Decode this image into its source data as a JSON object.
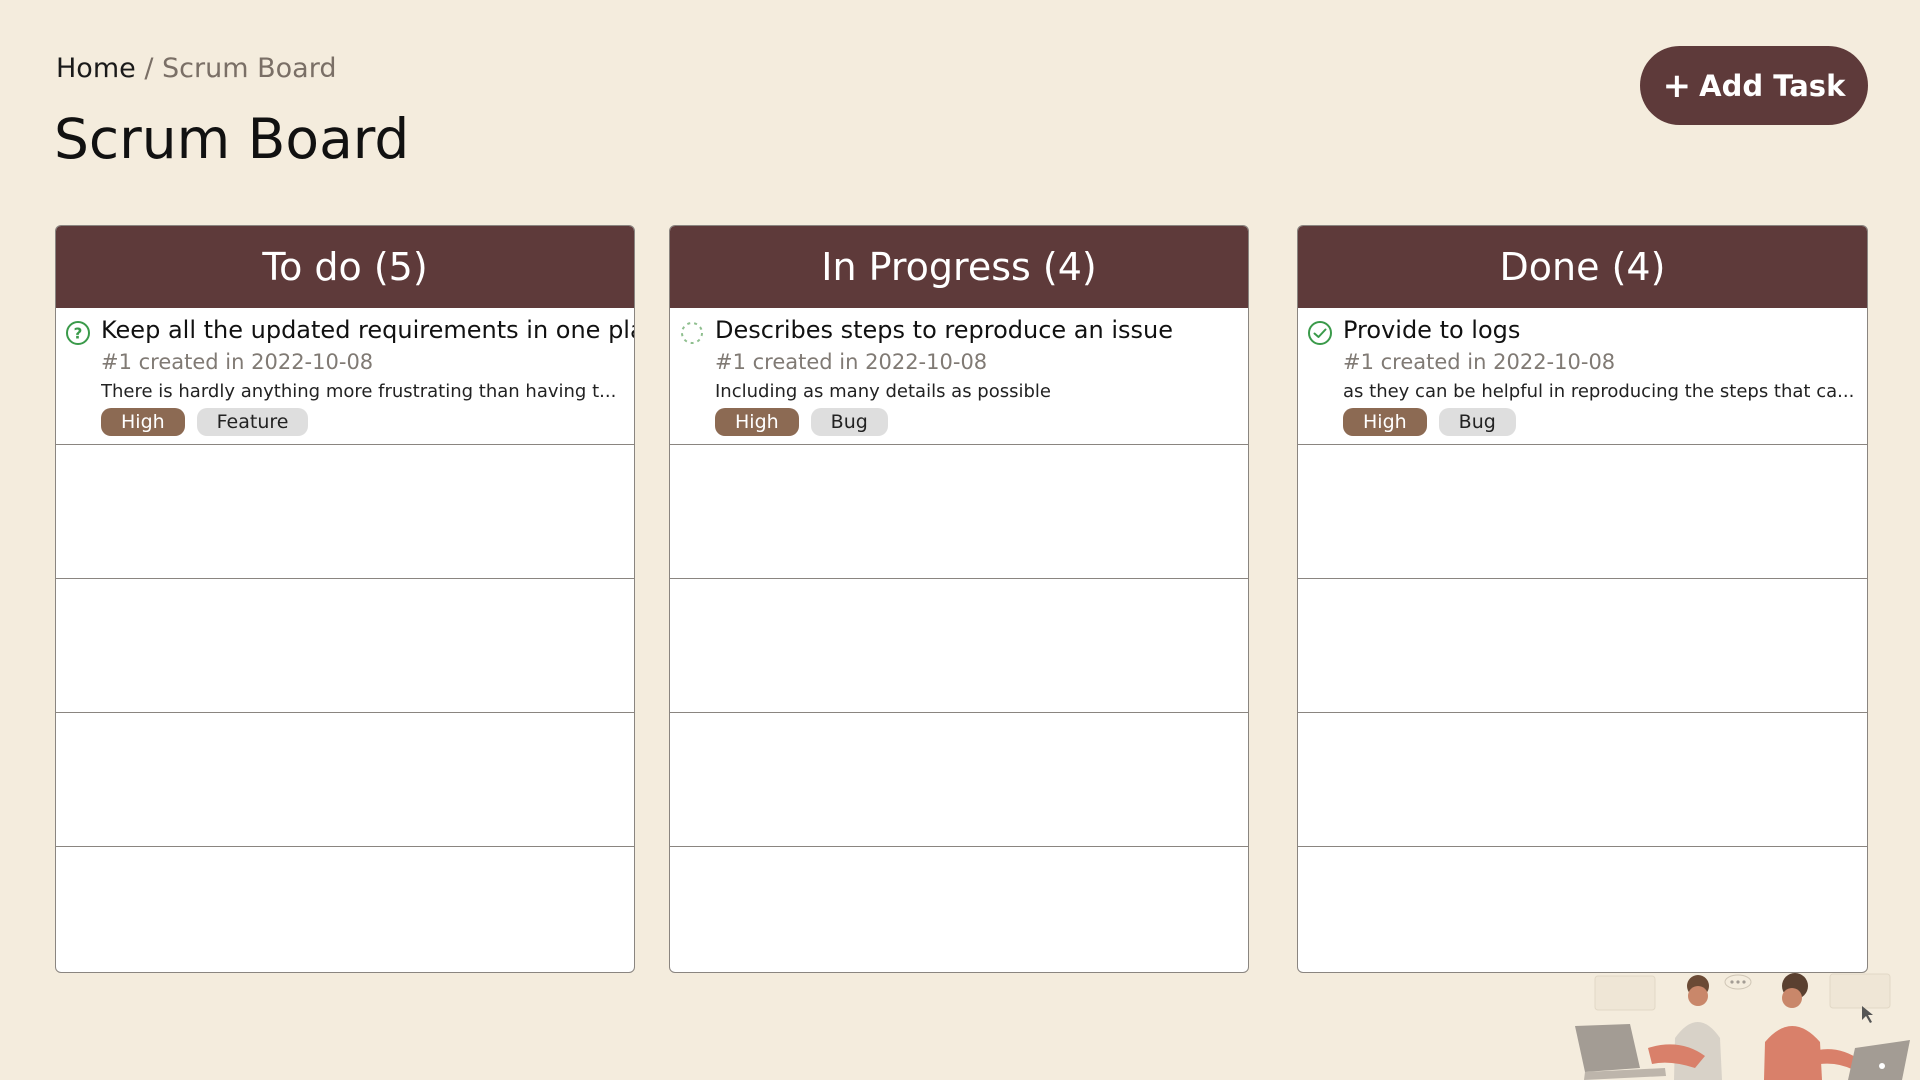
{
  "breadcrumb": {
    "home": "Home",
    "separator": "/",
    "current": "Scrum Board"
  },
  "page_title": "Scrum Board",
  "add_task": {
    "icon": "plus-icon",
    "label": "Add Task"
  },
  "colors": {
    "background": "#f4ecdd",
    "header": "#5e3a3a",
    "priority_tag": "#8c6a53",
    "type_tag": "#dedede",
    "status_green": "#3a9a4a"
  },
  "columns": [
    {
      "title": "To do (5)",
      "card": {
        "status_icon": "question-circle-icon",
        "title": "Keep all the updated requirements in one place",
        "meta": "#1 created in 2022-10-08",
        "description": "There is hardly anything more frustrating than having t...",
        "priority": "High",
        "type": "Feature"
      }
    },
    {
      "title": "In Progress (4)",
      "card": {
        "status_icon": "loading-spinner-icon",
        "title": "Describes steps to reproduce an issue",
        "meta": "#1 created in 2022-10-08",
        "description": "Including as many details as possible",
        "priority": "High",
        "type": "Bug"
      }
    },
    {
      "title": "Done (4)",
      "card": {
        "status_icon": "check-circle-icon",
        "title": "Provide to logs",
        "meta": "#1 created in 2022-10-08",
        "description": "as they can be helpful in reproducing the steps that ca...",
        "priority": "High",
        "type": "Bug"
      }
    }
  ]
}
